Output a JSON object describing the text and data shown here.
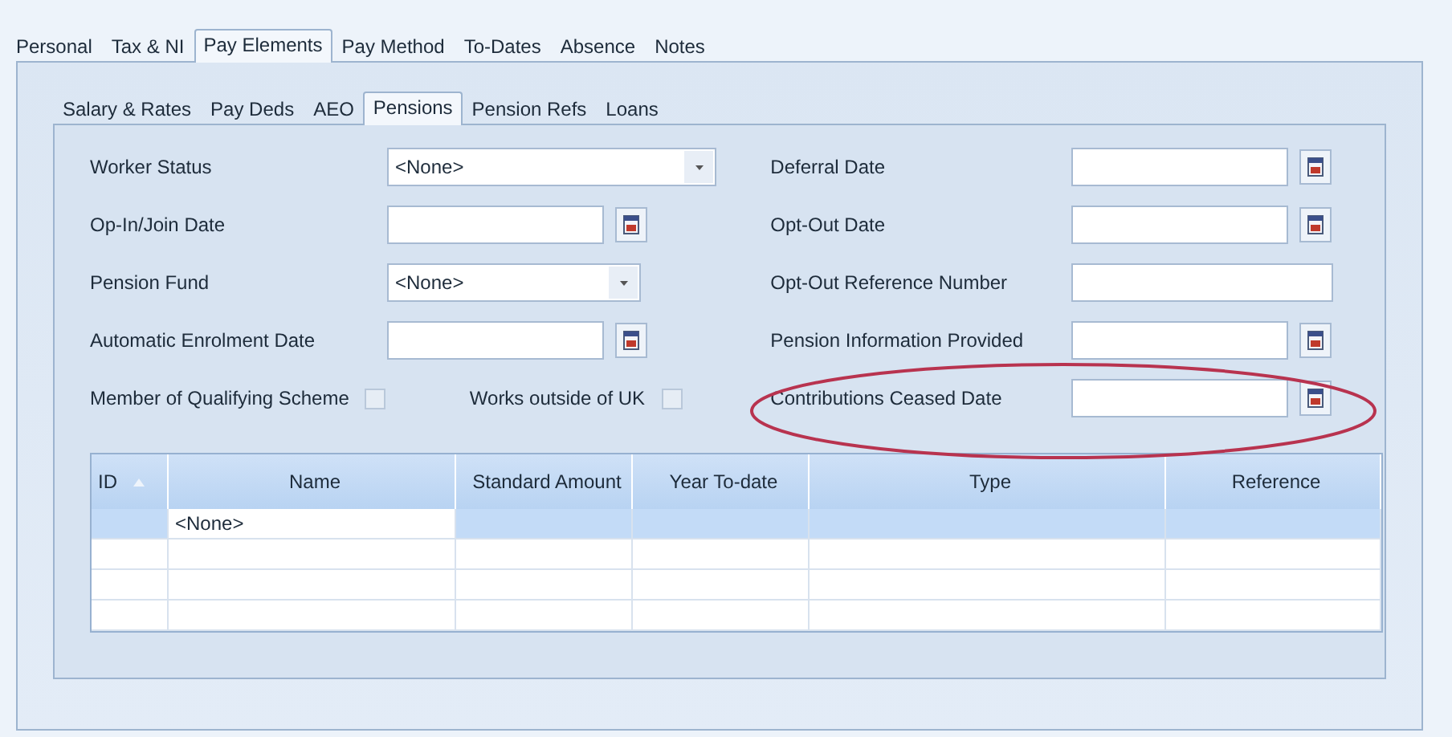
{
  "tabs": [
    {
      "label": "Personal",
      "selected": false
    },
    {
      "label": "Tax & NI",
      "selected": false
    },
    {
      "label": "Pay Elements",
      "selected": true
    },
    {
      "label": "Pay Method",
      "selected": false
    },
    {
      "label": "To-Dates",
      "selected": false
    },
    {
      "label": "Absence",
      "selected": false
    },
    {
      "label": "Notes",
      "selected": false
    }
  ],
  "sub_tabs": [
    {
      "label": "Salary & Rates",
      "selected": false
    },
    {
      "label": "Pay Deds",
      "selected": false
    },
    {
      "label": "AEO",
      "selected": false
    },
    {
      "label": "Pensions",
      "selected": true
    },
    {
      "label": "Pension Refs",
      "selected": false
    },
    {
      "label": "Loans",
      "selected": false
    }
  ],
  "form_rows": [
    {
      "left": {
        "label": "Worker Status",
        "kind": "select",
        "value": "<None>",
        "wide": true
      },
      "right": {
        "label": "Deferral Date",
        "kind": "date"
      }
    },
    {
      "left": {
        "label": "Op-In/Join Date",
        "kind": "date"
      },
      "right": {
        "label": "Opt-Out Date",
        "kind": "date"
      }
    },
    {
      "left": {
        "label": "Pension Fund",
        "kind": "select",
        "value": "<None>",
        "wide": false
      },
      "right": {
        "label": "Opt-Out Reference Number",
        "kind": "text"
      }
    },
    {
      "left": {
        "label": "Automatic Enrolment Date",
        "kind": "date"
      },
      "right": {
        "label": "Pension Information Provided",
        "kind": "date"
      }
    }
  ],
  "checkboxes": [
    {
      "label": "Member of Qualifying Scheme",
      "checked": false
    },
    {
      "label": "Works outside of UK",
      "checked": false
    }
  ],
  "ceased_date": {
    "label": "Contributions Ceased Date",
    "kind": "date",
    "highlighted": true
  },
  "table": {
    "columns": [
      {
        "label": "ID",
        "sorted": true
      },
      {
        "label": "Name"
      },
      {
        "label": "Standard Amount"
      },
      {
        "label": "Year To-date"
      },
      {
        "label": "Type"
      },
      {
        "label": "Reference"
      }
    ],
    "rows": [
      {
        "selected": true,
        "name": "<None>"
      },
      {
        "selected": false
      },
      {
        "selected": false
      },
      {
        "selected": false
      }
    ]
  }
}
